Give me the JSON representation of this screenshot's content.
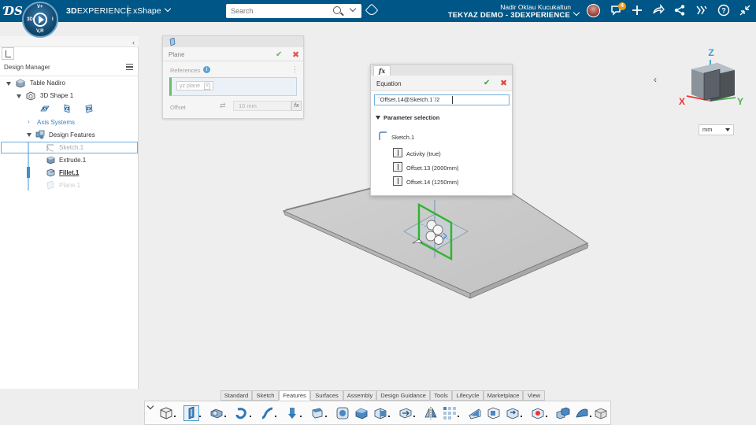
{
  "app": {
    "brand_bold": "3D",
    "brand_rest": "EXPERIENCE",
    "app_name": "xShape",
    "compass": {
      "top": "V+",
      "left": "3D",
      "right": "I",
      "bottom": "V,R"
    }
  },
  "search": {
    "placeholder": "Search"
  },
  "user": {
    "name": "Nadir Oktau Kucukaltun",
    "tenant": "TEKYAZ DEMO - 3DEXPERIENCE",
    "notifications": "4"
  },
  "design_manager": {
    "title": "Design Manager",
    "tree": {
      "root": "Table Nadiro",
      "shape": "3D Shape 1",
      "planes": [
        "XY",
        "YZ",
        "ZX"
      ],
      "axis_systems": "Axis Systems",
      "design_features": "Design Features",
      "features": [
        "Sketch.1",
        "Extrude.1",
        "Fillet.1",
        "Plane.1"
      ]
    }
  },
  "plane_dialog": {
    "title": "Plane",
    "references_label": "References",
    "reference_value": "yz plane",
    "offset_label": "Offset",
    "offset_value": "10 mm",
    "fx": "fx"
  },
  "equation_dialog": {
    "tab": "fx",
    "title": "Equation",
    "formula": "`Offset.14@Sketch.1`/2",
    "parameter_selection": "Parameter selection",
    "sketch": "Sketch.1",
    "params": [
      "Activity (true)",
      "Offset.13 (2000mm)",
      "Offset.14 (1250mm)"
    ]
  },
  "compass_axes": {
    "z": "Z",
    "x": "X",
    "y": "Y"
  },
  "units": "mm",
  "tabs": [
    "Standard",
    "Sketch",
    "Features",
    "Surfaces",
    "Assembly",
    "Design Guidance",
    "Tools",
    "Lifecycle",
    "Marketplace",
    "View"
  ],
  "active_tab": "Features",
  "colors": {
    "topbar": "#005686",
    "accent": "#4a9bd3",
    "ok": "#3f9e3a",
    "cancel": "#e04444",
    "plane_green": "#2fb52f"
  }
}
